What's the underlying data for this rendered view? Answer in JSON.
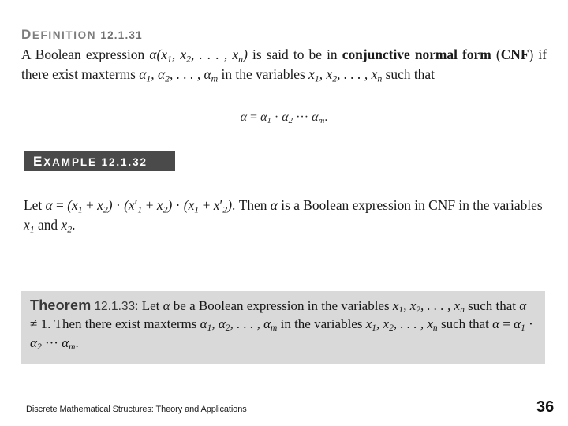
{
  "slide": {
    "page_number": "36",
    "footer": "Discrete Mathematical Structures: Theory and Applications",
    "colors": {
      "page_background": "#ffffff",
      "heading_gray": "#7d7d7d",
      "example_bar_background": "#4a4a4a",
      "example_bar_text": "#ffffff",
      "theorem_panel_background": "#d9d9d9",
      "body_text": "#1a1a1a"
    }
  },
  "definition": {
    "heading_label": "DEFINITION",
    "heading_number": "12.1.31",
    "heading_full": "DEFINITION 12.1.31",
    "body_plain": "A Boolean expression α(x1, x2, ..., xn) is said to be in conjunctive normal form (CNF) if there exist maxterms α1, α2, ..., αm in the variables x1, x2, ..., xn such that",
    "fragments": {
      "f1": "A Boolean expression ",
      "f2": " is said to be in ",
      "bold_term": "conjunctive normal form",
      "f3": " (",
      "bold_cnf": "CNF",
      "f4": ") if there exist maxterms ",
      "f5": " in the variables ",
      "f6": " such that"
    },
    "equation": "α = α1 · α2 ··· αm."
  },
  "example": {
    "heading_label": "EXAMPLE",
    "heading_number": "12.1.32",
    "heading_full": "EXAMPLE 12.1.32",
    "body_plain": "Let α = (x1 + x2) · (x1' + x2) · (x1 + x2'). Then α is a Boolean expression in CNF in the variables x1 and x2.",
    "fragments": {
      "f1": "Let ",
      "f2": " = ",
      "f3": ". Then ",
      "f4": " is a Boolean expression in CNF in the variables ",
      "f5": " and ",
      "f6": "."
    }
  },
  "theorem": {
    "label": "Theorem",
    "number": "12.1.33:",
    "body_plain": "Let α be a Boolean expression in the variables x1, x2, ..., xn such that α ≠ 1. Then there exist maxterms α1, α2, ..., αm in the variables x1, x2, ..., xn such that α = α1 · α2 ··· αm.",
    "fragments": {
      "f1": " Let ",
      "f2": " be a Boolean expression in the variables ",
      "f3": " such that ",
      "f4": " ≠ 1. Then there exist maxterms ",
      "f5": " in the variables ",
      "f6": " such that "
    }
  }
}
